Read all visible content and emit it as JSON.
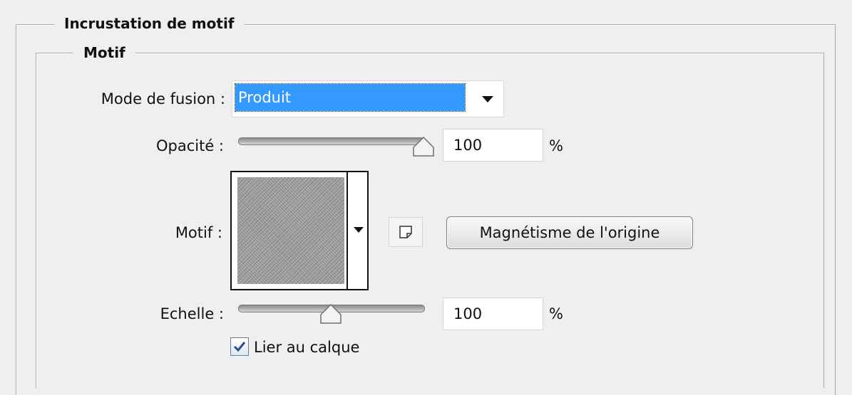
{
  "section": {
    "title": "Incrustation de motif",
    "group_title": "Motif"
  },
  "blend_mode": {
    "label": "Mode de fusion :",
    "selected": "Produit",
    "icon": "chevron-down-icon"
  },
  "opacity": {
    "label": "Opacité :",
    "value": "100",
    "unit": "%",
    "slider_fraction": 1.0
  },
  "pattern": {
    "label": "Motif :",
    "picker_icon": "chevron-down-icon",
    "new_preset_icon": "new-preset-icon",
    "snap_button": "Magnétisme de l'origine"
  },
  "scale": {
    "label": "Echelle :",
    "value": "100",
    "unit": "%",
    "slider_fraction": 0.5
  },
  "link_layer": {
    "label": "Lier au calque",
    "checked": true
  },
  "colors": {
    "selection": "#3399ff",
    "background": "#efefef"
  }
}
